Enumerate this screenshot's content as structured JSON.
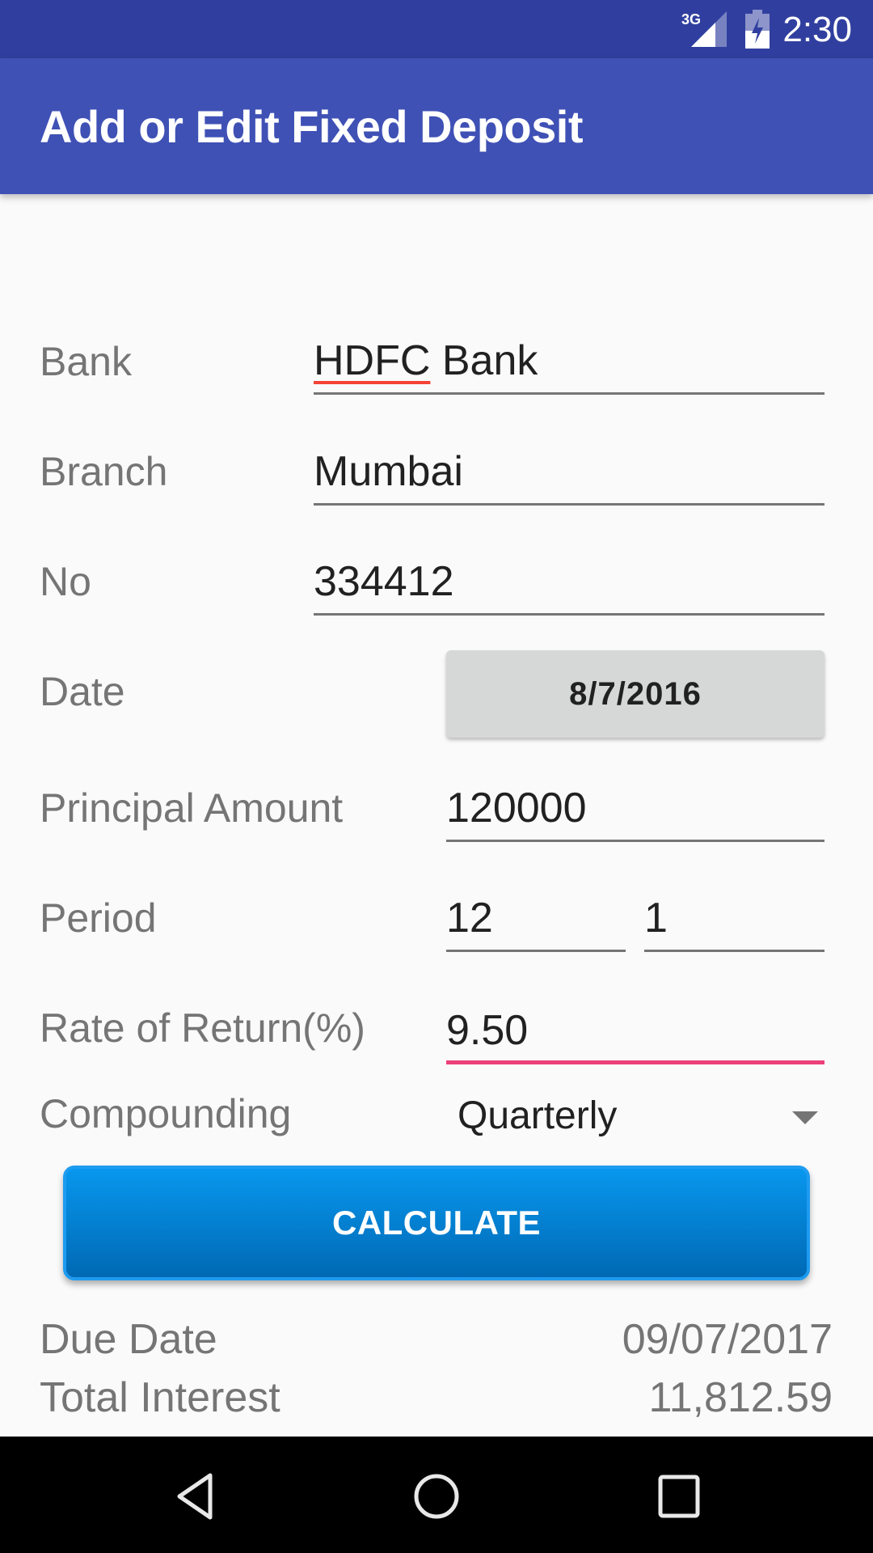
{
  "status_bar": {
    "network_label": "3G",
    "network_icon": "signal-icon",
    "battery_icon": "battery-charging-icon",
    "time": "2:30"
  },
  "app_bar": {
    "title": "Add or Edit Fixed Deposit"
  },
  "form": {
    "bank": {
      "label": "Bank",
      "value_misspelled": "HDFC",
      "value_rest": " Bank"
    },
    "branch": {
      "label": "Branch",
      "value": "Mumbai"
    },
    "number": {
      "label": "No",
      "value": "334412"
    },
    "date": {
      "label": "Date",
      "value": "8/7/2016"
    },
    "principal": {
      "label": "Principal Amount",
      "value": "120000"
    },
    "period": {
      "label": "Period",
      "value_months": "12",
      "value_days": "1"
    },
    "rate": {
      "label": "Rate of Return(%)",
      "value": "9.50"
    },
    "compounding": {
      "label": "Compounding",
      "selected": "Quarterly"
    }
  },
  "calculate_button": {
    "label": "CALCULATE"
  },
  "results": {
    "due_date": {
      "label": "Due Date",
      "value": "09/07/2017"
    },
    "total_interest": {
      "label": "Total Interest",
      "value": "11,812.59"
    }
  },
  "nav_bar": {
    "back": "back-icon",
    "home": "home-icon",
    "recents": "recents-icon"
  },
  "colors": {
    "primary": "#3f51b5",
    "primary_dark": "#303f9f",
    "accent": "#ec407a",
    "button": "#0288d1"
  }
}
